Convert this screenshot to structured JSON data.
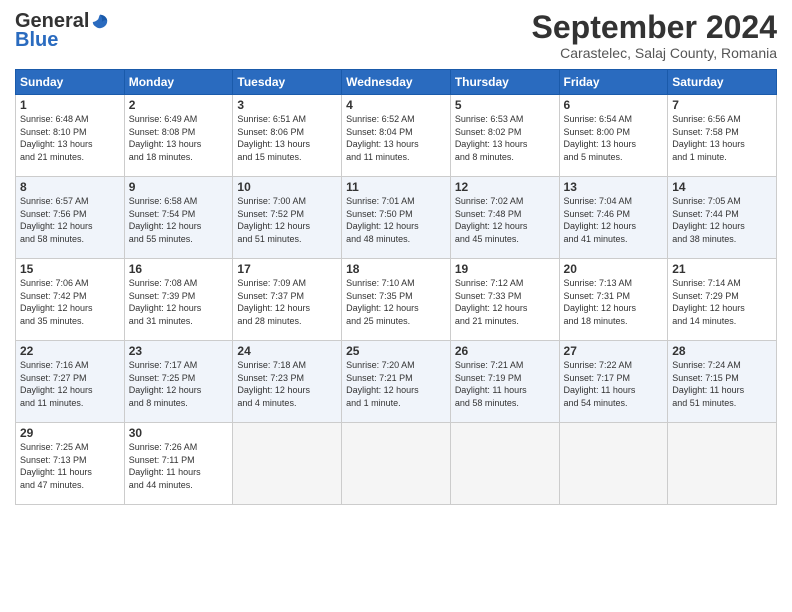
{
  "header": {
    "logo_general": "General",
    "logo_blue": "Blue",
    "month_title": "September 2024",
    "location": "Carastelec, Salaj County, Romania"
  },
  "weekdays": [
    "Sunday",
    "Monday",
    "Tuesday",
    "Wednesday",
    "Thursday",
    "Friday",
    "Saturday"
  ],
  "weeks": [
    [
      {
        "day": 1,
        "info": "Sunrise: 6:48 AM\nSunset: 8:10 PM\nDaylight: 13 hours\nand 21 minutes."
      },
      {
        "day": 2,
        "info": "Sunrise: 6:49 AM\nSunset: 8:08 PM\nDaylight: 13 hours\nand 18 minutes."
      },
      {
        "day": 3,
        "info": "Sunrise: 6:51 AM\nSunset: 8:06 PM\nDaylight: 13 hours\nand 15 minutes."
      },
      {
        "day": 4,
        "info": "Sunrise: 6:52 AM\nSunset: 8:04 PM\nDaylight: 13 hours\nand 11 minutes."
      },
      {
        "day": 5,
        "info": "Sunrise: 6:53 AM\nSunset: 8:02 PM\nDaylight: 13 hours\nand 8 minutes."
      },
      {
        "day": 6,
        "info": "Sunrise: 6:54 AM\nSunset: 8:00 PM\nDaylight: 13 hours\nand 5 minutes."
      },
      {
        "day": 7,
        "info": "Sunrise: 6:56 AM\nSunset: 7:58 PM\nDaylight: 13 hours\nand 1 minute."
      }
    ],
    [
      {
        "day": 8,
        "info": "Sunrise: 6:57 AM\nSunset: 7:56 PM\nDaylight: 12 hours\nand 58 minutes."
      },
      {
        "day": 9,
        "info": "Sunrise: 6:58 AM\nSunset: 7:54 PM\nDaylight: 12 hours\nand 55 minutes."
      },
      {
        "day": 10,
        "info": "Sunrise: 7:00 AM\nSunset: 7:52 PM\nDaylight: 12 hours\nand 51 minutes."
      },
      {
        "day": 11,
        "info": "Sunrise: 7:01 AM\nSunset: 7:50 PM\nDaylight: 12 hours\nand 48 minutes."
      },
      {
        "day": 12,
        "info": "Sunrise: 7:02 AM\nSunset: 7:48 PM\nDaylight: 12 hours\nand 45 minutes."
      },
      {
        "day": 13,
        "info": "Sunrise: 7:04 AM\nSunset: 7:46 PM\nDaylight: 12 hours\nand 41 minutes."
      },
      {
        "day": 14,
        "info": "Sunrise: 7:05 AM\nSunset: 7:44 PM\nDaylight: 12 hours\nand 38 minutes."
      }
    ],
    [
      {
        "day": 15,
        "info": "Sunrise: 7:06 AM\nSunset: 7:42 PM\nDaylight: 12 hours\nand 35 minutes."
      },
      {
        "day": 16,
        "info": "Sunrise: 7:08 AM\nSunset: 7:39 PM\nDaylight: 12 hours\nand 31 minutes."
      },
      {
        "day": 17,
        "info": "Sunrise: 7:09 AM\nSunset: 7:37 PM\nDaylight: 12 hours\nand 28 minutes."
      },
      {
        "day": 18,
        "info": "Sunrise: 7:10 AM\nSunset: 7:35 PM\nDaylight: 12 hours\nand 25 minutes."
      },
      {
        "day": 19,
        "info": "Sunrise: 7:12 AM\nSunset: 7:33 PM\nDaylight: 12 hours\nand 21 minutes."
      },
      {
        "day": 20,
        "info": "Sunrise: 7:13 AM\nSunset: 7:31 PM\nDaylight: 12 hours\nand 18 minutes."
      },
      {
        "day": 21,
        "info": "Sunrise: 7:14 AM\nSunset: 7:29 PM\nDaylight: 12 hours\nand 14 minutes."
      }
    ],
    [
      {
        "day": 22,
        "info": "Sunrise: 7:16 AM\nSunset: 7:27 PM\nDaylight: 12 hours\nand 11 minutes."
      },
      {
        "day": 23,
        "info": "Sunrise: 7:17 AM\nSunset: 7:25 PM\nDaylight: 12 hours\nand 8 minutes."
      },
      {
        "day": 24,
        "info": "Sunrise: 7:18 AM\nSunset: 7:23 PM\nDaylight: 12 hours\nand 4 minutes."
      },
      {
        "day": 25,
        "info": "Sunrise: 7:20 AM\nSunset: 7:21 PM\nDaylight: 12 hours\nand 1 minute."
      },
      {
        "day": 26,
        "info": "Sunrise: 7:21 AM\nSunset: 7:19 PM\nDaylight: 11 hours\nand 58 minutes."
      },
      {
        "day": 27,
        "info": "Sunrise: 7:22 AM\nSunset: 7:17 PM\nDaylight: 11 hours\nand 54 minutes."
      },
      {
        "day": 28,
        "info": "Sunrise: 7:24 AM\nSunset: 7:15 PM\nDaylight: 11 hours\nand 51 minutes."
      }
    ],
    [
      {
        "day": 29,
        "info": "Sunrise: 7:25 AM\nSunset: 7:13 PM\nDaylight: 11 hours\nand 47 minutes."
      },
      {
        "day": 30,
        "info": "Sunrise: 7:26 AM\nSunset: 7:11 PM\nDaylight: 11 hours\nand 44 minutes."
      },
      null,
      null,
      null,
      null,
      null
    ]
  ]
}
